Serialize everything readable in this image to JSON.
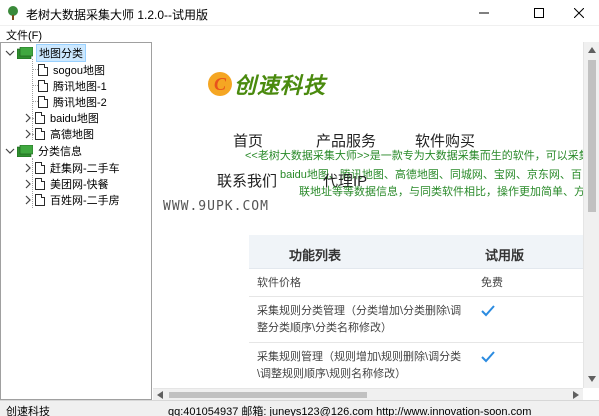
{
  "window": {
    "title": "老树大数据采集大师 1.2.0--试用版"
  },
  "menu": {
    "file": "文件(F)"
  },
  "tree": {
    "groups": [
      {
        "label": "地图分类",
        "selected": true,
        "items": [
          "sogou地图",
          "腾讯地图-1",
          "腾讯地图-2",
          "baidu地图",
          "高德地图"
        ]
      },
      {
        "label": "分类信息",
        "selected": false,
        "items": [
          "赶集网-二手车",
          "美团网-快餐",
          "百姓网-二手房"
        ]
      }
    ]
  },
  "web": {
    "logo_letter": "C",
    "logo_text": "创速科技",
    "nav": {
      "home": "首页",
      "products": "产品服务",
      "purchase": "软件购买",
      "contact": "联系我们",
      "agent": "代理IP"
    },
    "marquee_line1": "<<老树大数据采集大师>>是一款专为大数据采集而生的软件，可以采集",
    "marquee_line2": "baidu地图、腾讯地图、高德地图、同城网、宝网、京东网、百",
    "marquee_line3": "联地址等等数据信息，与同类软件相比，操作更加简单、方便、直观",
    "watermark": "WWW.9UPK.COM",
    "table": {
      "col_feature": "功能列表",
      "col_trial": "试用版",
      "rows": [
        {
          "feature": "软件价格",
          "trial": "免费"
        },
        {
          "feature": "采集规则分类管理（分类增加\\分类删除\\调整分类顺序\\分类名称修改）",
          "trial": "check"
        },
        {
          "feature": "采集规则管理（规则增加\\规则删除\\调分类\\调整规则顺序\\规则名称修改）",
          "trial": "check"
        }
      ]
    }
  },
  "status": {
    "left": "创速科技",
    "right": "qq:401054937 邮箱: juneys123@126.com http://www.innovation-soon.com"
  },
  "colors": {
    "accent_green": "#2a8a2a",
    "logo_green": "#4a8a0e",
    "check_blue": "#2b8be0"
  }
}
